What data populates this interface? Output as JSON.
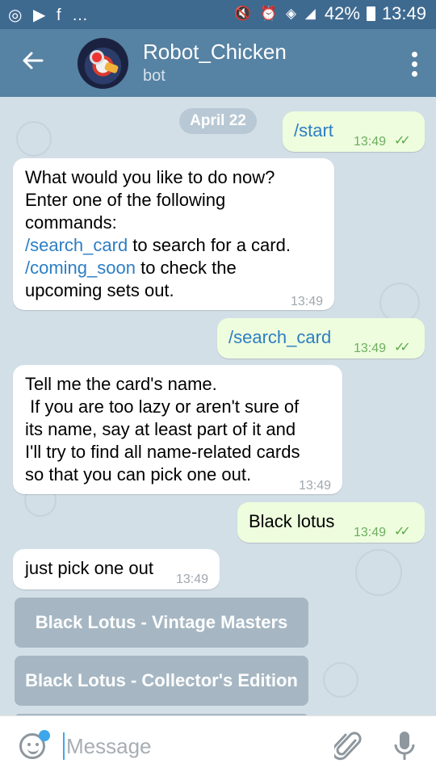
{
  "status_bar": {
    "left_icons": "◎ ▶ f …",
    "right_icons": "🔇 ⏰ ◈ ◢",
    "battery": "42%",
    "time": "13:49"
  },
  "header": {
    "title": "Robot_Chicken",
    "subtitle": "bot"
  },
  "date_pill": "April 22",
  "messages": [
    {
      "dir": "out",
      "text": "/start",
      "time": "13:49"
    },
    {
      "dir": "in",
      "line1": "What would you like to do now?",
      "line2": "Enter one of the following",
      "line3": "commands:",
      "cmd1": "/search_card",
      "cmd1_rest": " to search for a card.",
      "cmd2": "/coming_soon",
      "cmd2_rest": " to check the",
      "line6": "upcoming sets out.",
      "time": "13:49"
    },
    {
      "dir": "out",
      "text": "/search_card",
      "time": "13:49"
    },
    {
      "dir": "in",
      "line1": "Tell me the card's name.",
      "line2": " If you are too lazy or aren't sure of",
      "line3": "its name, say at least part of it and",
      "line4": "I'll try to find all name-related cards",
      "line5": "so that you can pick one out.",
      "time": "13:49"
    },
    {
      "dir": "out",
      "text": "Black lotus",
      "time": "13:49"
    },
    {
      "dir": "in",
      "text": "just pick one out",
      "time": "13:49"
    }
  ],
  "keyboard": [
    "Black Lotus - Vintage Masters",
    "Black Lotus - Collector's Edition"
  ],
  "input": {
    "placeholder": "Message"
  },
  "icons": {
    "back": "arrow-left-icon",
    "menu": "more-vertical-icon",
    "emoji": "smile-icon",
    "attach": "paperclip-icon",
    "mic": "microphone-icon",
    "read": "double-check-icon"
  },
  "colors": {
    "header": "#5682a3",
    "statusbar": "#3f6a90",
    "outgoing_bubble": "#eefdde",
    "incoming_bubble": "#ffffff",
    "command_link": "#2c7ec4",
    "read_checks": "#5ea94e"
  }
}
